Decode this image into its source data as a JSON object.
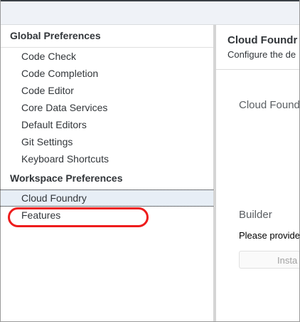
{
  "sidebar": {
    "global_title": "Global Preferences",
    "global_items": [
      "Code Check",
      "Code Completion",
      "Code Editor",
      "Core Data Services",
      "Default Editors",
      "Git Settings",
      "Keyboard Shortcuts"
    ],
    "workspace_title": "Workspace Preferences",
    "workspace_items": [
      "Cloud Foundry",
      "Features"
    ],
    "selected": "Cloud Foundry",
    "highlighted": "Features"
  },
  "main": {
    "title": "Cloud Foundr",
    "subtitle": "Configure the de",
    "section_cloud_foundry": "Cloud Found",
    "section_builder": "Builder",
    "builder_prompt": "Please provide",
    "install_button": "Insta"
  },
  "colors": {
    "highlight": "#ee1c1c",
    "selected_bg": "#e7eef6"
  }
}
